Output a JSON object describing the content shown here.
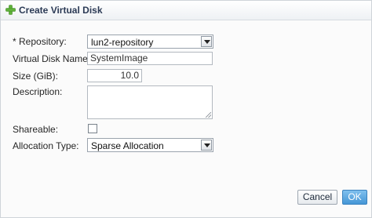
{
  "dialog": {
    "title": "Create Virtual Disk",
    "icon": "plus-icon",
    "accent_color": "#5fb13a"
  },
  "form": {
    "repository_label": "* Repository:",
    "repository_value": "lun2-repository",
    "disk_name_label": "Virtual Disk Name:",
    "disk_name_value": "SystemImage",
    "size_label": "Size (GiB):",
    "size_value": "10.0",
    "description_label": "Description:",
    "description_value": "",
    "shareable_label": "Shareable:",
    "shareable_checked": false,
    "allocation_label": "Allocation Type:",
    "allocation_value": "Sparse Allocation"
  },
  "buttons": {
    "cancel_label": "Cancel",
    "ok_label": "OK"
  }
}
